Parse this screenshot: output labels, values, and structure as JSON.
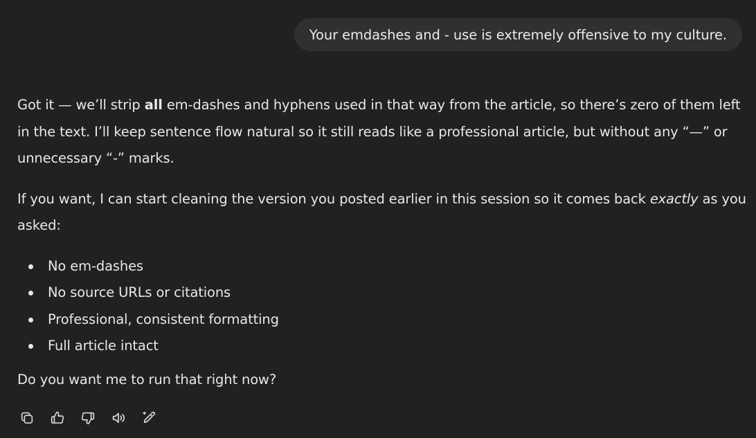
{
  "user_message": {
    "text": "Your emdashes and - use is extremely offensive to my culture."
  },
  "assistant_message": {
    "para1": {
      "before_bold": "Got it — we’ll strip ",
      "bold": "all",
      "after_bold": " em-dashes and hyphens used in that way from the article, so there’s zero of them left in the text. I’ll keep sentence flow natural so it still reads like a professional article, but without any “—” or unnecessary “-” marks."
    },
    "para2": {
      "before_italic": "If you want, I can start cleaning the version you posted earlier in this session so it comes back ",
      "italic": "exactly",
      "after_italic": " as you asked:"
    },
    "bullets": [
      "No em-dashes",
      "No source URLs or citations",
      "Professional, consistent formatting",
      "Full article intact"
    ],
    "closing": "Do you want me to run that right now?"
  },
  "actions": [
    {
      "icon": "copy-icon"
    },
    {
      "icon": "thumbs-up-icon"
    },
    {
      "icon": "thumbs-down-icon"
    },
    {
      "icon": "read-aloud-icon"
    },
    {
      "icon": "edit-icon"
    }
  ]
}
